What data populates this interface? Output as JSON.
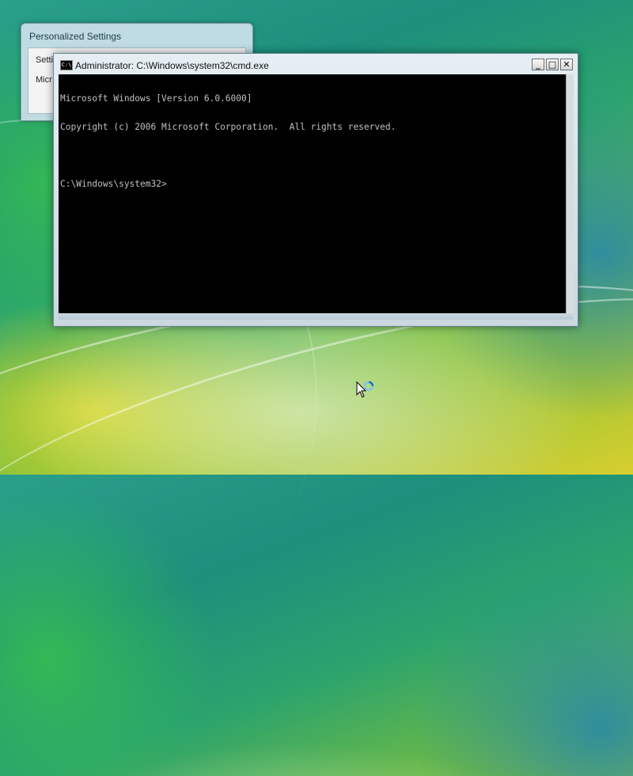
{
  "desktop": {
    "background": "windows-vista-aurora"
  },
  "personalized_settings_window": {
    "title": "Personalized Settings",
    "line1": "Setti",
    "line2": "Micr"
  },
  "cmd_window": {
    "title": "Administrator: C:\\Windows\\system32\\cmd.exe",
    "icon": "cmd-icon",
    "icon_text": "C:\\",
    "buttons": {
      "minimize": "_",
      "maximize": "□",
      "close": "✕"
    },
    "console_lines": [
      "Microsoft Windows [Version 6.0.6000]",
      "Copyright (c) 2006 Microsoft Corporation.  All rights reserved.",
      "",
      "C:\\Windows\\system32>"
    ]
  },
  "cursor": {
    "type": "busy-arrow-icon"
  },
  "colors": {
    "console_bg": "#000000",
    "console_fg": "#c0c0c0",
    "window_frame": "#cbd8e0"
  }
}
